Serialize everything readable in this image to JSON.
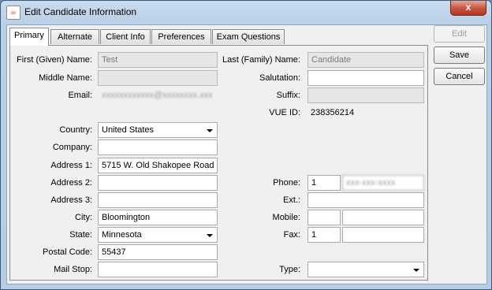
{
  "window": {
    "title": "Edit Candidate Information",
    "close_label": "x"
  },
  "tabs": [
    "Primary",
    "Alternate",
    "Client Info",
    "Preferences",
    "Exam Questions"
  ],
  "buttons": {
    "edit": "Edit",
    "save": "Save",
    "cancel": "Cancel"
  },
  "left": {
    "first_name_label": "First (Given) Name:",
    "first_name": "Test",
    "middle_name_label": "Middle Name:",
    "middle_name": "",
    "email_label": "Email:",
    "email": "xxxxxxxxxxxx@xxxxxxxx.xxx",
    "country_label": "Country:",
    "country": "United States",
    "company_label": "Company:",
    "company": "",
    "address1_label": "Address 1:",
    "address1": "5715 W. Old Shakopee Road",
    "address2_label": "Address 2:",
    "address2": "",
    "address3_label": "Address 3:",
    "address3": "",
    "city_label": "City:",
    "city": "Bloomington",
    "state_label": "State:",
    "state": "Minnesota",
    "postal_label": "Postal Code:",
    "postal": "55437",
    "mailstop_label": "Mail Stop:",
    "mailstop": ""
  },
  "right": {
    "last_name_label": "Last (Family) Name:",
    "last_name": "Candidate",
    "salutation_label": "Salutation:",
    "salutation": "",
    "suffix_label": "Suffix:",
    "suffix": "",
    "vue_id_label": "VUE ID:",
    "vue_id": "238356214",
    "phone_label": "Phone:",
    "phone_cc": "1",
    "phone_num": "xxx-xxx-xxxx",
    "ext_label": "Ext.:",
    "ext": "",
    "mobile_label": "Mobile:",
    "mobile_cc": "",
    "mobile_num": "",
    "fax_label": "Fax:",
    "fax_cc": "1",
    "fax_num": "",
    "type_label": "Type:",
    "type": ""
  }
}
